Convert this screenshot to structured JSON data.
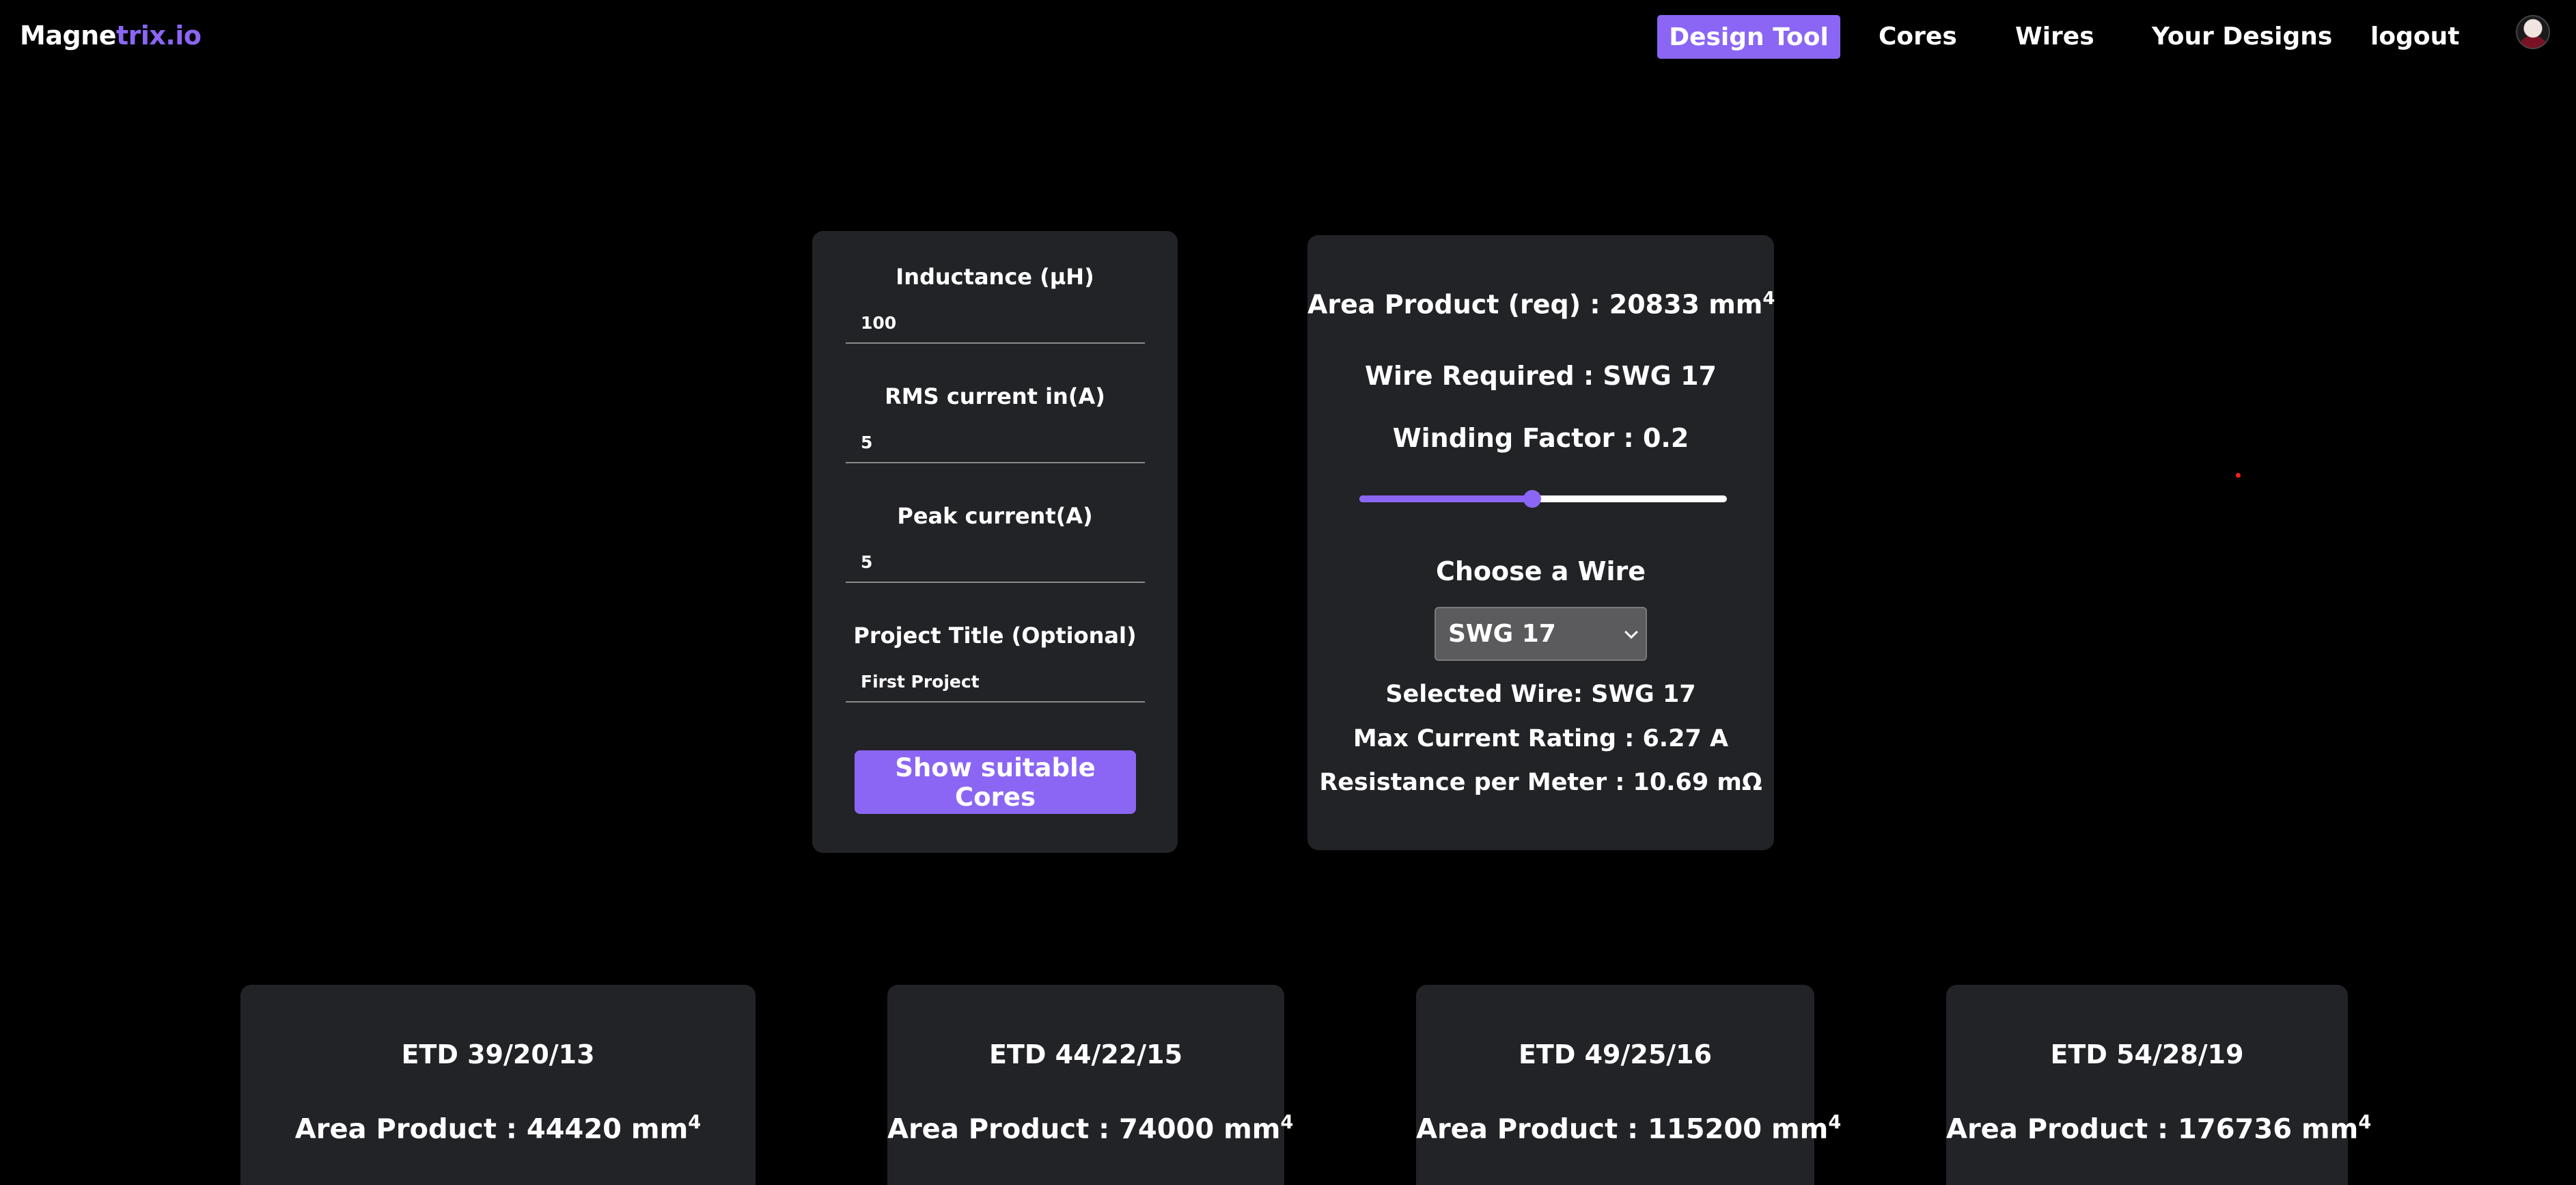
{
  "nav": {
    "logo_part1": "Magne",
    "logo_part2": "trix.io",
    "items": [
      {
        "label": "Design Tool",
        "active": true
      },
      {
        "label": "Cores"
      },
      {
        "label": "Wires"
      },
      {
        "label": "Your Designs"
      },
      {
        "label": "logout"
      }
    ]
  },
  "form": {
    "inductance_label": "Inductance (µH)",
    "inductance_value": "100",
    "rms_label": "RMS current in(A)",
    "rms_value": "5",
    "peak_label": "Peak current(A)",
    "peak_value": "5",
    "title_label": "Project Title (Optional)",
    "title_value": "First Project",
    "submit_label": "Show suitable Cores"
  },
  "results": {
    "area_product_text": "Area Product (req) : 20833 mm",
    "area_product_exp": "4",
    "wire_required": "Wire Required : SWG 17",
    "winding_factor": "Winding Factor : 0.2",
    "winding_slider_fraction": 0.47,
    "choose_wire_label": "Choose a Wire",
    "wire_select_value": "SWG 17",
    "selected_wire": "Selected Wire: SWG 17",
    "max_current": "Max Current Rating : 6.27 A",
    "resistance": "Resistance per Meter : 10.69 mΩ"
  },
  "cores": [
    {
      "name": "ETD 39/20/13",
      "area_text": "Area Product : 44420 mm",
      "exp": "4"
    },
    {
      "name": "ETD 44/22/15",
      "area_text": "Area Product : 74000 mm",
      "exp": "4"
    },
    {
      "name": "ETD 49/25/16",
      "area_text": "Area Product : 115200 mm",
      "exp": "4"
    },
    {
      "name": "ETD 54/28/19",
      "area_text": "Area Product : 176736 mm",
      "exp": "4"
    }
  ],
  "colors": {
    "accent": "#8b66f5",
    "card": "#222326",
    "background": "#000000"
  }
}
